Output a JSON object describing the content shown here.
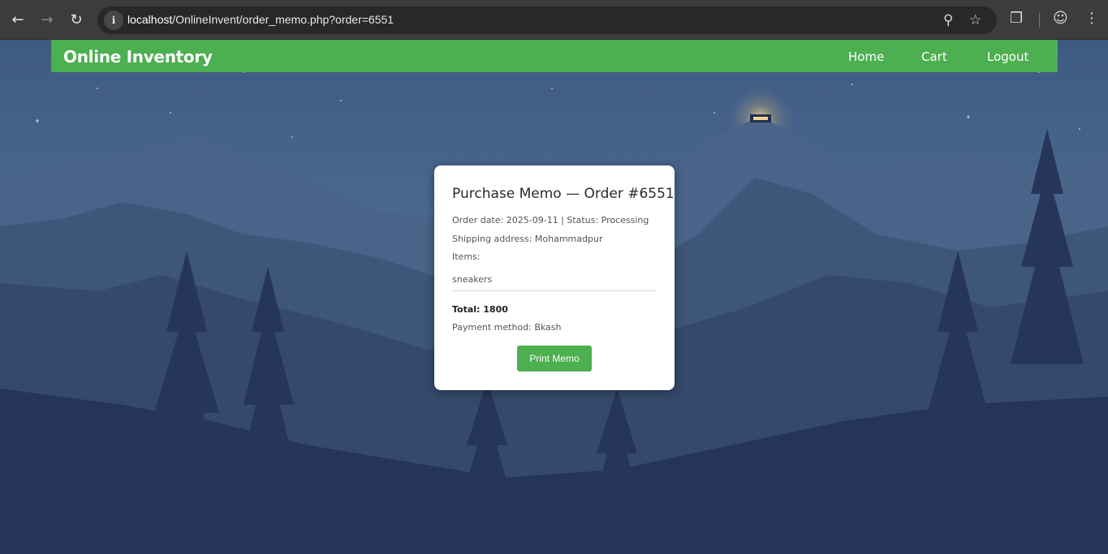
{
  "browser": {
    "url_host": "localhost",
    "url_path": "/OnlineInvent/order_memo.php?order=6551",
    "icons": [
      "back-arrow-icon",
      "forward-arrow-icon",
      "reload-icon",
      "site-info-icon",
      "zoom-icon",
      "bookmark-star-icon",
      "extensions-icon",
      "profile-icon",
      "menu-kebab-icon"
    ]
  },
  "navbar": {
    "brand": "Online Inventory",
    "links": [
      "Home",
      "Cart",
      "Logout"
    ],
    "color": "#4caf50"
  },
  "memo": {
    "title": "Purchase Memo — Order #6551",
    "order_line": "Order date: 2025-09-11 | Status: Processing",
    "shipping_line": "Shipping address: Mohammadpur",
    "items_label": "Items:",
    "items": [
      "sneakers"
    ],
    "total_line": "Total: 1800",
    "payment_line": "Payment method: Bkash",
    "print_button": "Print Memo"
  }
}
